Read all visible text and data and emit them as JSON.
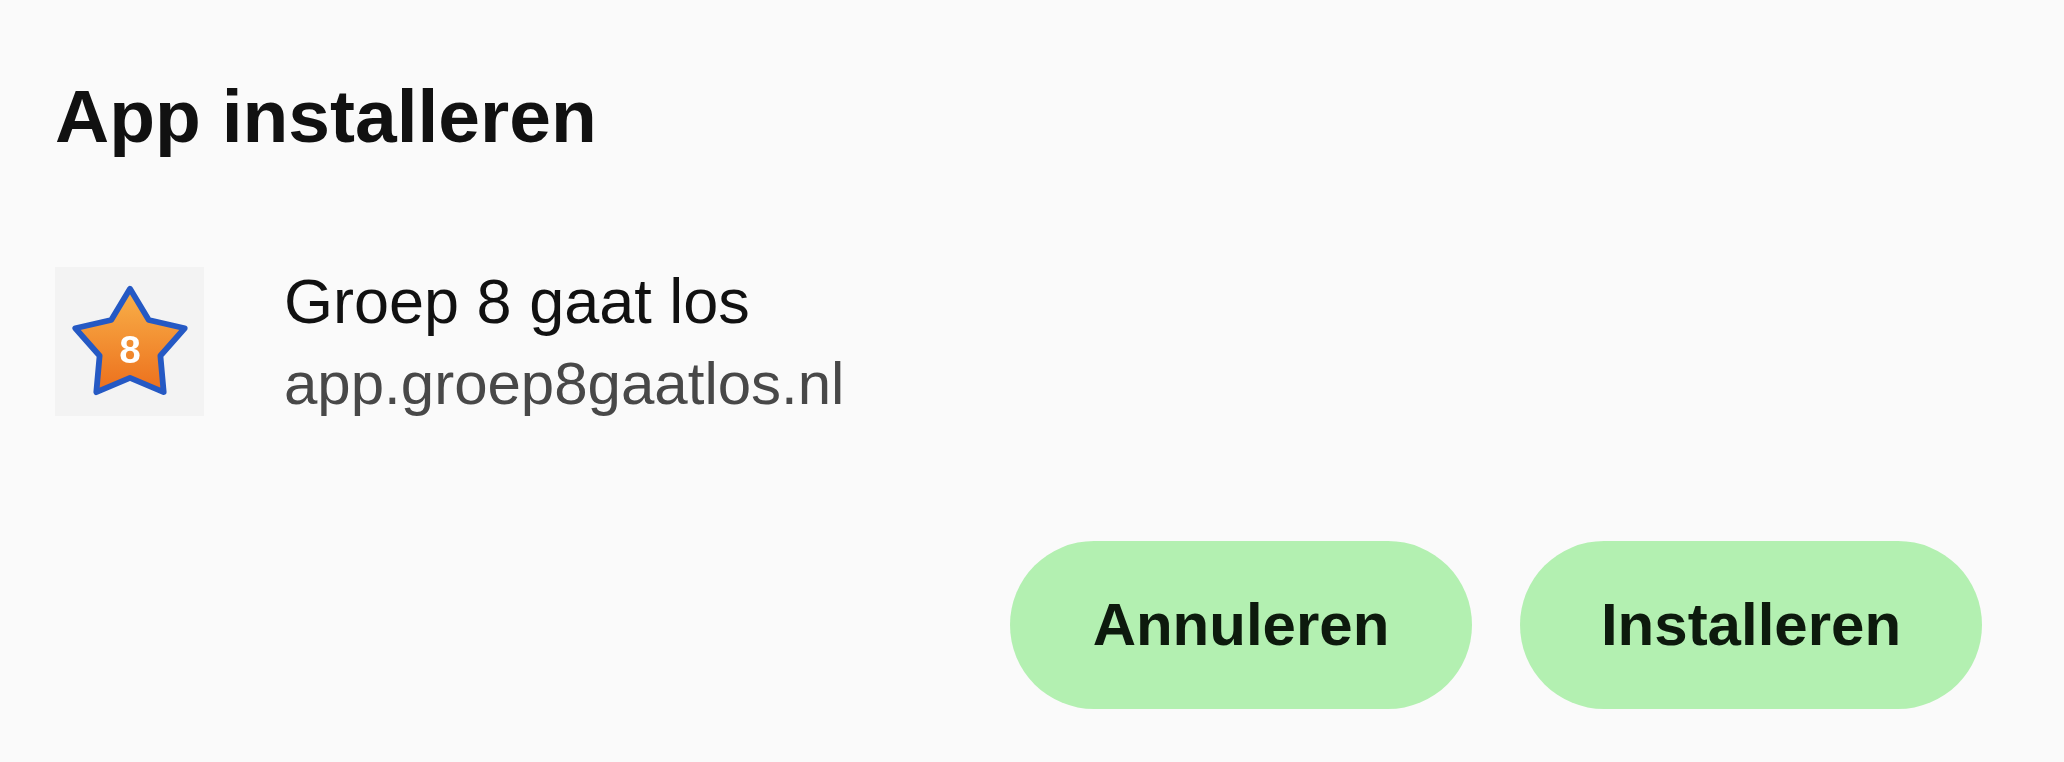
{
  "dialog": {
    "title": "App installeren"
  },
  "app": {
    "icon_number": "8",
    "name": "Groep 8 gaat los",
    "url": "app.groep8gaatlos.nl"
  },
  "buttons": [
    {
      "label": "Annuleren"
    },
    {
      "label": "Installeren"
    }
  ]
}
